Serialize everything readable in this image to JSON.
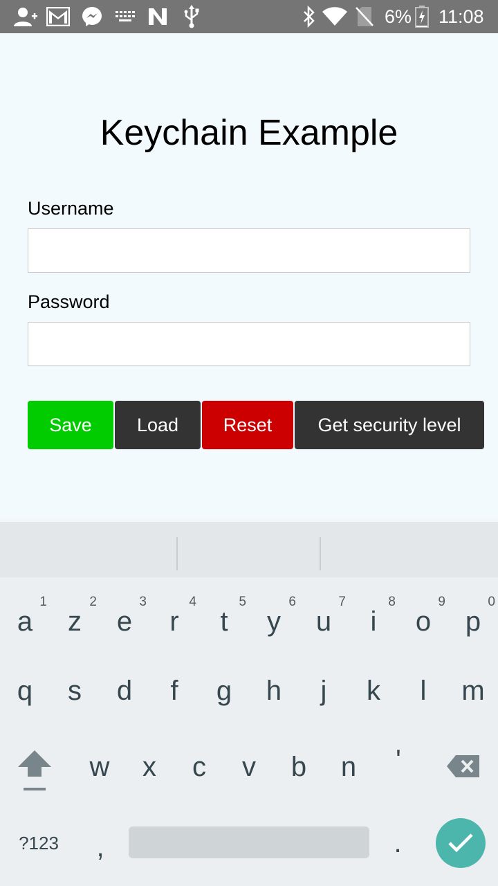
{
  "status_bar": {
    "battery": "6%",
    "time": "11:08",
    "left_icons": [
      "add-contact-icon",
      "gmail-icon",
      "messenger-icon",
      "keyboard-icon",
      "n-app-icon",
      "usb-icon"
    ],
    "right_icons": [
      "bluetooth-icon",
      "wifi-icon",
      "no-sim-icon",
      "battery-charging-icon"
    ]
  },
  "app": {
    "title": "Keychain Example",
    "username": {
      "label": "Username",
      "value": ""
    },
    "password": {
      "label": "Password",
      "value": ""
    },
    "buttons": {
      "save": "Save",
      "load": "Load",
      "reset": "Reset",
      "security": "Get security level"
    },
    "colors": {
      "save": "#00cc00",
      "load": "#333333",
      "reset": "#cc0000",
      "security": "#333333",
      "background": "#f3fafd"
    }
  },
  "keyboard": {
    "row1": [
      {
        "k": "a",
        "n": "1"
      },
      {
        "k": "z",
        "n": "2"
      },
      {
        "k": "e",
        "n": "3"
      },
      {
        "k": "r",
        "n": "4"
      },
      {
        "k": "t",
        "n": "5"
      },
      {
        "k": "y",
        "n": "6"
      },
      {
        "k": "u",
        "n": "7"
      },
      {
        "k": "i",
        "n": "8"
      },
      {
        "k": "o",
        "n": "9"
      },
      {
        "k": "p",
        "n": "0"
      }
    ],
    "row2": [
      "q",
      "s",
      "d",
      "f",
      "g",
      "h",
      "j",
      "k",
      "l",
      "m"
    ],
    "row3": [
      "w",
      "x",
      "c",
      "v",
      "b",
      "n",
      "'"
    ],
    "symbols_key": "?123",
    "comma": ",",
    "period": ".",
    "accent_color": "#4db6ac"
  }
}
